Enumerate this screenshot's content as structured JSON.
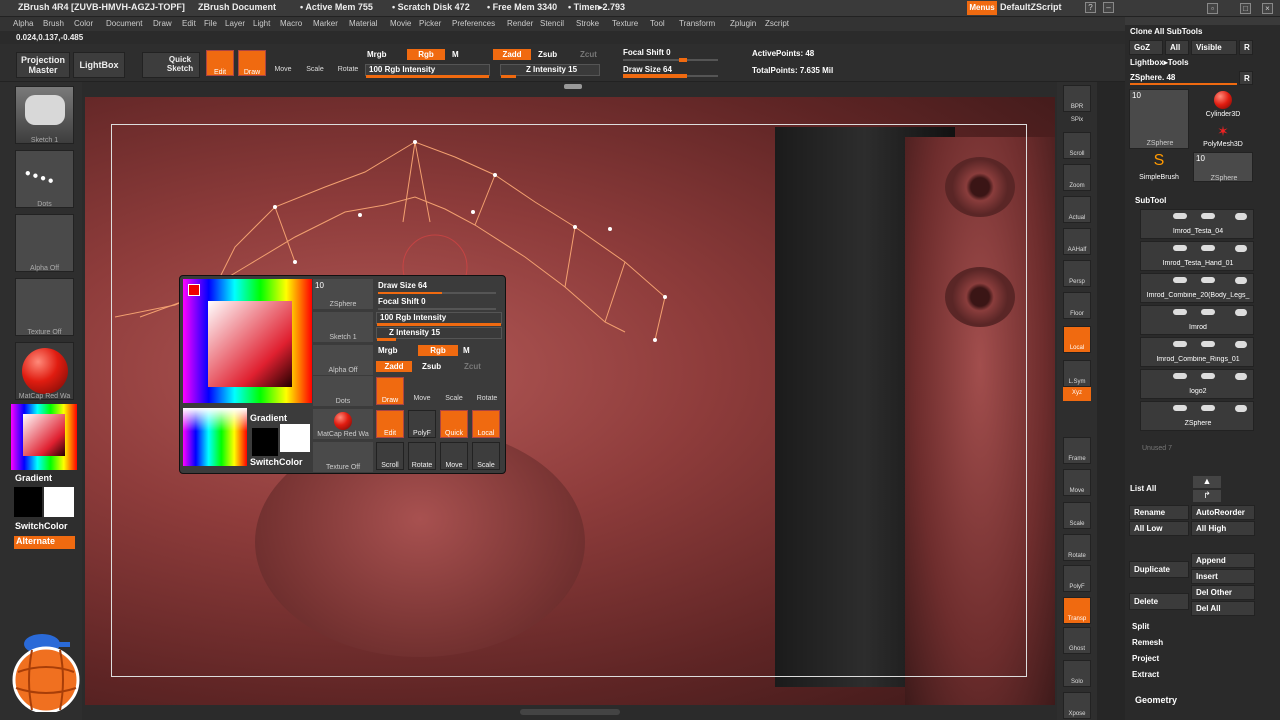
{
  "titlebar": {
    "app": "ZBrush 4R4 [ZUVB-HMVH-AGZJ-TOPF]",
    "doc": "ZBrush Document",
    "active_mem": "• Active Mem 755",
    "scratch": "• Scratch Disk 472",
    "free_mem": "• Free Mem 3340",
    "timer": "• Timer▸2.793",
    "menus": "Menus",
    "script": "DefaultZScript"
  },
  "menubar": [
    "Alpha",
    "Brush",
    "Color",
    "Document",
    "Draw",
    "Edit",
    "File",
    "Layer",
    "Light",
    "Macro",
    "Marker",
    "Material",
    "Movie",
    "Picker",
    "Preferences",
    "Render",
    "Stencil",
    "Stroke",
    "Texture",
    "Tool",
    "Transform",
    "Zplugin",
    "Zscript"
  ],
  "coords": "0.024,0.137,-0.485",
  "toolbar": {
    "projection_master": "Projection Master",
    "lightbox": "LightBox",
    "quick_sketch": "Quick Sketch",
    "edit": "Edit",
    "draw": "Draw",
    "move": "Move",
    "scale": "Scale",
    "rotate": "Rotate",
    "mrgb": "Mrgb",
    "rgb": "Rgb",
    "m": "M",
    "zadd": "Zadd",
    "zsub": "Zsub",
    "zcut": "Zcut",
    "rgb_intensity": "100 Rgb Intensity",
    "z_intensity": "Z Intensity 15",
    "focal_shift": "Focal Shift 0",
    "draw_size": "Draw Size 64",
    "active_points": "ActivePoints: 48",
    "total_points": "TotalPoints: 7.635 Mil"
  },
  "leftshelf": {
    "sketch": "Sketch 1",
    "dots": "Dots",
    "alpha": "Alpha Off",
    "texture": "Texture Off",
    "matcap": "MatCap Red Wa",
    "gradient": "Gradient",
    "switchcolor": "SwitchColor",
    "alternate": "Alternate"
  },
  "popup": {
    "num": "10",
    "zsphere": "ZSphere",
    "sketch": "Sketch 1",
    "alpha": "Alpha Off",
    "dots": "Dots",
    "matcap": "MatCap Red Wa",
    "texture": "Texture Off",
    "gradient": "Gradient",
    "switchcolor": "SwitchColor",
    "draw_size": "Draw Size 64",
    "focal_shift": "Focal Shift 0",
    "rgb_intensity": "100 Rgb Intensity",
    "z_intensity": "Z Intensity 15",
    "mrgb": "Mrgb",
    "rgb": "Rgb",
    "m": "M",
    "zadd": "Zadd",
    "zsub": "Zsub",
    "zcut": "Zcut",
    "draw": "Draw",
    "move": "Move",
    "scale": "Scale",
    "rotate": "Rotate",
    "edit": "Edit",
    "polyf": "PolyF",
    "quick": "Quick",
    "local": "Local",
    "scroll": "Scroll",
    "rotate2": "Rotate",
    "move2": "Move",
    "scale2": "Scale"
  },
  "rshelf": [
    "BPR",
    "SPix",
    "Scroll",
    "Zoom",
    "Actual",
    "AAHalf",
    "Persp",
    "Floor",
    "Local",
    "L.Sym",
    "Xyz",
    "",
    "",
    "Frame",
    "Move",
    "Scale",
    "Rotate",
    "PolyF",
    "Transp",
    "Ghost",
    "Solo",
    "Xpose"
  ],
  "rpanel": {
    "clone": "Clone All SubTools",
    "goz": "GoZ",
    "all": "All",
    "visible": "Visible",
    "r": "R",
    "lightbox_tools": "Lightbox▸Tools",
    "zsphere_48": "ZSphere. 48",
    "r2": "R",
    "n10": "10",
    "zsphere": "ZSphere",
    "cylinder": "Cylinder3D",
    "polymesh": "PolyMesh3D",
    "simplebrush": "SimpleBrush",
    "n10b": "10",
    "zsphere2": "ZSphere",
    "subtool": "SubTool",
    "subtools": [
      "Imrod_Testa_04",
      "Imrod_Testa_Hand_01",
      "Imrod_Combine_20(Body_Legs_",
      "Imrod",
      "Imrod_Combine_Rings_01",
      "logo2",
      "ZSphere"
    ],
    "unused": "Unused 7",
    "list_all": "List All",
    "rename": "Rename",
    "autoreorder": "AutoReorder",
    "all_low": "All Low",
    "all_high": "All High",
    "duplicate": "Duplicate",
    "append": "Append",
    "insert": "Insert",
    "delete": "Delete",
    "del_other": "Del Other",
    "del_all": "Del All",
    "split": "Split",
    "remesh": "Remesh",
    "project": "Project",
    "extract": "Extract",
    "geometry": "Geometry"
  },
  "colors": {
    "accent": "#f06a10",
    "panel": "#2e2e2e",
    "mesh": "#9a4443"
  }
}
